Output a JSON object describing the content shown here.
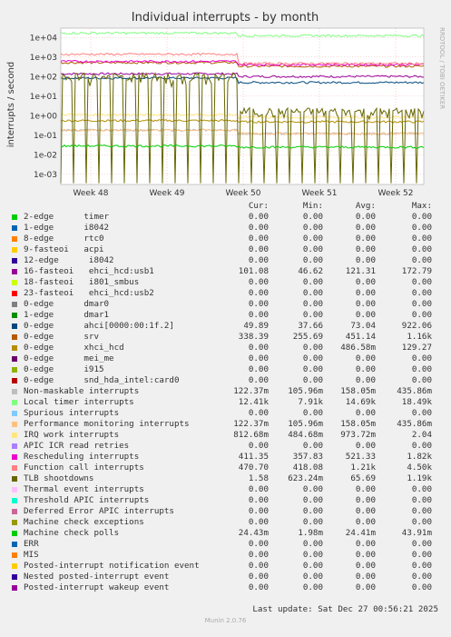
{
  "chart_data": {
    "type": "line",
    "title": "Individual interrupts - by month",
    "ylabel": "interrupts / second",
    "yscale": "log",
    "ylim": [
      0.0003,
      30000
    ],
    "y_ticks": [
      "1e+04",
      "1e+03",
      "1e+02",
      "1e+01",
      "1e+00",
      "1e-01",
      "1e-02",
      "1e-03"
    ],
    "x_ticks": [
      "Week 48",
      "Week 49",
      "Week 50",
      "Week 51",
      "Week 52"
    ],
    "grid": true,
    "side_credit": "RRDTOOL / TOBI OETIKER",
    "columns": [
      "Cur:",
      "Min:",
      "Avg:",
      "Max:"
    ],
    "series": [
      {
        "name": "2-edge      timer",
        "color": "#00cc00",
        "cur": "0.00",
        "min": "0.00",
        "avg": "0.00",
        "max": "0.00"
      },
      {
        "name": "1-edge      i8042",
        "color": "#0066b3",
        "cur": "0.00",
        "min": "0.00",
        "avg": "0.00",
        "max": "0.00"
      },
      {
        "name": "8-edge      rtc0",
        "color": "#ff8000",
        "cur": "0.00",
        "min": "0.00",
        "avg": "0.00",
        "max": "0.00"
      },
      {
        "name": "9-fasteoi   acpi",
        "color": "#ffcc00",
        "cur": "0.00",
        "min": "0.00",
        "avg": "0.00",
        "max": "0.00"
      },
      {
        "name": "12-edge      i8042",
        "color": "#330099",
        "cur": "0.00",
        "min": "0.00",
        "avg": "0.00",
        "max": "0.00"
      },
      {
        "name": "16-fasteoi   ehci_hcd:usb1",
        "color": "#990099",
        "cur": "101.08",
        "min": "46.62",
        "avg": "121.31",
        "max": "172.79"
      },
      {
        "name": "18-fasteoi   i801_smbus",
        "color": "#ccff00",
        "cur": "0.00",
        "min": "0.00",
        "avg": "0.00",
        "max": "0.00"
      },
      {
        "name": "23-fasteoi   ehci_hcd:usb2",
        "color": "#ff0000",
        "cur": "0.00",
        "min": "0.00",
        "avg": "0.00",
        "max": "0.00"
      },
      {
        "name": "0-edge      dmar0",
        "color": "#808080",
        "cur": "0.00",
        "min": "0.00",
        "avg": "0.00",
        "max": "0.00"
      },
      {
        "name": "1-edge      dmar1",
        "color": "#008f00",
        "cur": "0.00",
        "min": "0.00",
        "avg": "0.00",
        "max": "0.00"
      },
      {
        "name": "0-edge      ahci[0000:00:1f.2]",
        "color": "#00487d",
        "cur": "49.89",
        "min": "37.66",
        "avg": "73.04",
        "max": "922.06"
      },
      {
        "name": "0-edge      srv",
        "color": "#b35a00",
        "cur": "338.39",
        "min": "255.69",
        "avg": "451.14",
        "max": "1.16k"
      },
      {
        "name": "0-edge      xhci_hcd",
        "color": "#b38f00",
        "cur": "0.00",
        "min": "0.00",
        "avg": "486.58m",
        "max": "129.27"
      },
      {
        "name": "0-edge      mei_me",
        "color": "#6b006b",
        "cur": "0.00",
        "min": "0.00",
        "avg": "0.00",
        "max": "0.00"
      },
      {
        "name": "0-edge      i915",
        "color": "#8fb300",
        "cur": "0.00",
        "min": "0.00",
        "avg": "0.00",
        "max": "0.00"
      },
      {
        "name": "0-edge      snd_hda_intel:card0",
        "color": "#b30000",
        "cur": "0.00",
        "min": "0.00",
        "avg": "0.00",
        "max": "0.00"
      },
      {
        "name": "Non-maskable interrupts",
        "color": "#bebebe",
        "cur": "122.37m",
        "min": "105.96m",
        "avg": "158.05m",
        "max": "435.86m"
      },
      {
        "name": "Local timer interrupts",
        "color": "#80ff80",
        "cur": "12.41k",
        "min": "7.91k",
        "avg": "14.69k",
        "max": "18.49k"
      },
      {
        "name": "Spurious interrupts",
        "color": "#80c9ff",
        "cur": "0.00",
        "min": "0.00",
        "avg": "0.00",
        "max": "0.00"
      },
      {
        "name": "Performance monitoring interrupts",
        "color": "#ffc080",
        "cur": "122.37m",
        "min": "105.96m",
        "avg": "158.05m",
        "max": "435.86m"
      },
      {
        "name": "IRQ work interrupts",
        "color": "#ffe680",
        "cur": "812.68m",
        "min": "484.68m",
        "avg": "973.72m",
        "max": "2.04"
      },
      {
        "name": "APIC ICR read retries",
        "color": "#aa80ff",
        "cur": "0.00",
        "min": "0.00",
        "avg": "0.00",
        "max": "0.00"
      },
      {
        "name": "Rescheduling interrupts",
        "color": "#ee00cc",
        "cur": "411.35",
        "min": "357.83",
        "avg": "521.33",
        "max": "1.82k"
      },
      {
        "name": "Function call interrupts",
        "color": "#ff8080",
        "cur": "470.70",
        "min": "418.08",
        "avg": "1.21k",
        "max": "4.50k"
      },
      {
        "name": "TLB shootdowns",
        "color": "#666600",
        "cur": "1.58",
        "min": "623.24m",
        "avg": "65.69",
        "max": "1.19k"
      },
      {
        "name": "Thermal event interrupts",
        "color": "#ffbfff",
        "cur": "0.00",
        "min": "0.00",
        "avg": "0.00",
        "max": "0.00"
      },
      {
        "name": "Threshold APIC interrupts",
        "color": "#00ffcc",
        "cur": "0.00",
        "min": "0.00",
        "avg": "0.00",
        "max": "0.00"
      },
      {
        "name": "Deferred Error APIC interrupts",
        "color": "#cc6699",
        "cur": "0.00",
        "min": "0.00",
        "avg": "0.00",
        "max": "0.00"
      },
      {
        "name": "Machine check exceptions",
        "color": "#999900",
        "cur": "0.00",
        "min": "0.00",
        "avg": "0.00",
        "max": "0.00"
      },
      {
        "name": "Machine check polls",
        "color": "#00cc00",
        "cur": "24.43m",
        "min": "1.98m",
        "avg": "24.41m",
        "max": "43.91m"
      },
      {
        "name": "ERR",
        "color": "#0066b3",
        "cur": "0.00",
        "min": "0.00",
        "avg": "0.00",
        "max": "0.00"
      },
      {
        "name": "MIS",
        "color": "#ff8000",
        "cur": "0.00",
        "min": "0.00",
        "avg": "0.00",
        "max": "0.00"
      },
      {
        "name": "Posted-interrupt notification event",
        "color": "#ffcc00",
        "cur": "0.00",
        "min": "0.00",
        "avg": "0.00",
        "max": "0.00"
      },
      {
        "name": "Nested posted-interrupt event",
        "color": "#330099",
        "cur": "0.00",
        "min": "0.00",
        "avg": "0.00",
        "max": "0.00"
      },
      {
        "name": "Posted-interrupt wakeup event",
        "color": "#990099",
        "cur": "0.00",
        "min": "0.00",
        "avg": "0.00",
        "max": "0.00"
      }
    ],
    "last_update": "Last update: Sat Dec 27 00:56:21 2025",
    "footer": "Munin 2.0.76"
  }
}
